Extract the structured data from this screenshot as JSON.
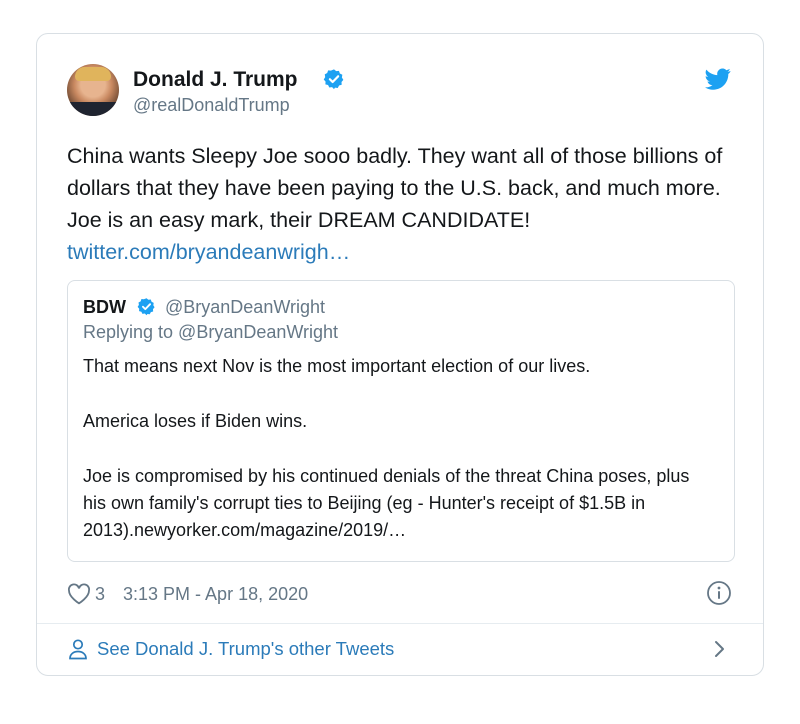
{
  "tweet": {
    "author_name": "Donald J. Trump",
    "author_handle": "@realDonaldTrump",
    "text": "China wants Sleepy Joe sooo badly. They want all of those billions of dollars that they have been paying to the U.S. back, and much more. Joe is an easy mark, their DREAM CANDIDATE! ",
    "link": "twitter.com/bryandeanwrigh…",
    "likes": "3",
    "timestamp": "3:13 PM - Apr 18, 2020"
  },
  "quoted": {
    "author_name": "BDW",
    "author_handle": "@BryanDeanWright",
    "replying_to": "Replying to @BryanDeanWright",
    "paragraphs": [
      "That means next Nov is the most important election of our lives.",
      "America loses if Biden wins.",
      "Joe is compromised by his continued denials of the threat China poses, plus his own family's corrupt ties to Beijing (eg - Hunter's receipt of $1.5B in 2013).newyorker.com/magazine/2019/…"
    ]
  },
  "footer": {
    "see_more": "See Donald J. Trump's other Tweets"
  },
  "colors": {
    "link_blue": "#2b7bb9",
    "twitter_blue": "#1da1f2",
    "muted": "#657786",
    "border": "#d9dfe4"
  },
  "icons": [
    "verified-badge-icon",
    "twitter-bird-icon",
    "heart-icon",
    "info-icon",
    "person-icon",
    "chevron-right-icon"
  ]
}
